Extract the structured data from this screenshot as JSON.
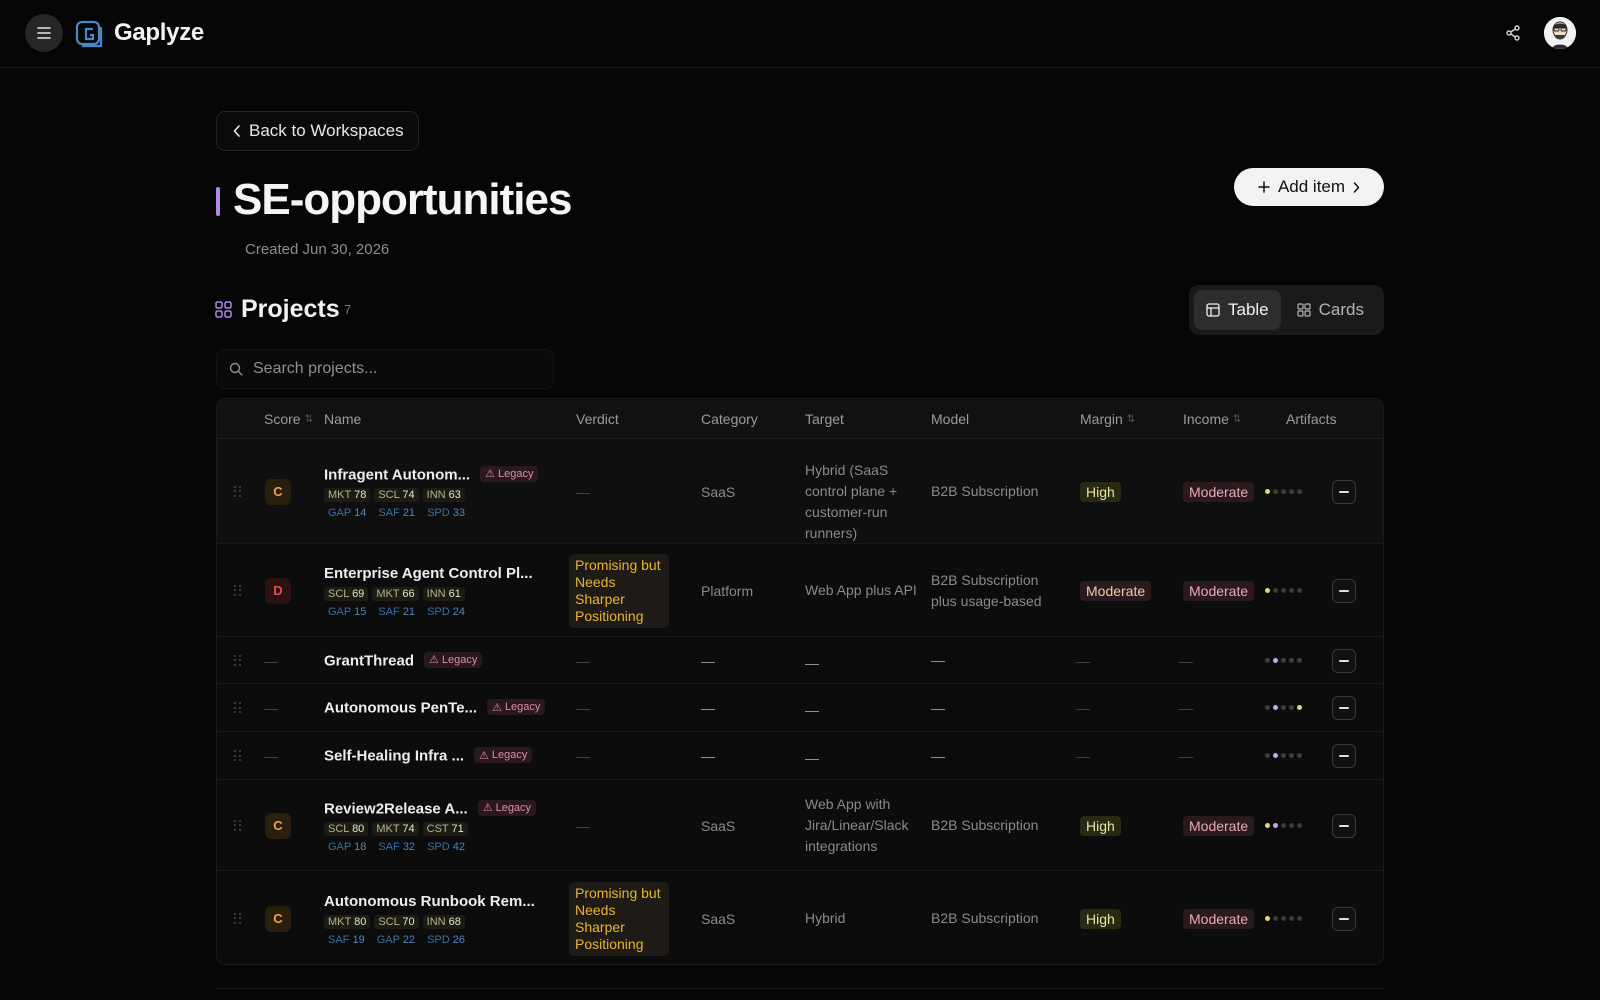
{
  "app": {
    "name": "Gaplyze"
  },
  "nav": {
    "back_label": "Back to Workspaces"
  },
  "page": {
    "title": "SE-opportunities",
    "created": "Created Jun 30, 2026",
    "add_label": "Add item"
  },
  "section": {
    "title": "Projects",
    "count": "7"
  },
  "views": {
    "table": "Table",
    "cards": "Cards",
    "active": "Table"
  },
  "search": {
    "placeholder": "Search projects..."
  },
  "columns": [
    "Score",
    "Name",
    "Verdict",
    "Category",
    "Target",
    "Model",
    "Margin",
    "Income",
    "Artifacts"
  ],
  "dash": "—",
  "legacy_label": "Legacy",
  "rows": [
    {
      "grade": "C",
      "name": "Infragent Autonom...",
      "legacy": true,
      "metrics1": [
        [
          "MKT",
          "78"
        ],
        [
          "SCL",
          "74"
        ],
        [
          "INN",
          "63"
        ]
      ],
      "metrics2": [
        [
          "GAP",
          "14"
        ],
        [
          "SAF",
          "21"
        ],
        [
          "SPD",
          "33"
        ]
      ],
      "verdict": "—",
      "category": "SaaS",
      "target": "Hybrid (SaaS control plane + customer-run runners)",
      "model": "B2B Subscription",
      "margin": "High",
      "income": "Moderate",
      "artifacts": [
        "y",
        "g",
        "g",
        "g",
        "g"
      ]
    },
    {
      "grade": "D",
      "name": "Enterprise Agent Control Pl...",
      "legacy": false,
      "metrics1": [
        [
          "SCL",
          "69"
        ],
        [
          "MKT",
          "66"
        ],
        [
          "INN",
          "61"
        ]
      ],
      "metrics2": [
        [
          "GAP",
          "15"
        ],
        [
          "SAF",
          "21"
        ],
        [
          "SPD",
          "24"
        ]
      ],
      "verdict": "Promising but Needs Sharper Positioning",
      "category": "Platform",
      "target": "Web App plus API",
      "model": "B2B Subscription plus usage-based",
      "margin": "Moderate",
      "income": "Moderate",
      "artifacts": [
        "y",
        "g",
        "g",
        "g",
        "g"
      ]
    },
    {
      "grade": "—",
      "name": "GrantThread",
      "legacy": true,
      "verdict": "—",
      "category": "—",
      "target": "—",
      "model": "—",
      "margin": "—",
      "income": "—",
      "artifacts": [
        "g",
        "p",
        "g",
        "g",
        "g"
      ]
    },
    {
      "grade": "—",
      "name": "Autonomous PenTe...",
      "legacy": true,
      "verdict": "—",
      "category": "—",
      "target": "—",
      "model": "—",
      "margin": "—",
      "income": "—",
      "artifacts": [
        "g",
        "p",
        "g",
        "g",
        "y"
      ]
    },
    {
      "grade": "—",
      "name": "Self-Healing Infra ...",
      "legacy": true,
      "verdict": "—",
      "category": "—",
      "target": "—",
      "model": "—",
      "margin": "—",
      "income": "—",
      "artifacts": [
        "g",
        "p",
        "g",
        "g",
        "g"
      ]
    },
    {
      "grade": "C",
      "name": "Review2Release A...",
      "legacy": true,
      "metrics1": [
        [
          "SCL",
          "80"
        ],
        [
          "MKT",
          "74"
        ],
        [
          "CST",
          "71"
        ]
      ],
      "metrics2": [
        [
          "GAP",
          "18"
        ],
        [
          "SAF",
          "32"
        ],
        [
          "SPD",
          "42"
        ]
      ],
      "verdict": "—",
      "category": "SaaS",
      "target": "Web App with Jira/Linear/Slack integrations",
      "model": "B2B Subscription",
      "margin": "High",
      "income": "Moderate",
      "artifacts": [
        "y",
        "p",
        "g",
        "g",
        "g"
      ]
    },
    {
      "grade": "C",
      "name": "Autonomous Runbook Rem...",
      "legacy": false,
      "metrics1": [
        [
          "MKT",
          "80"
        ],
        [
          "SCL",
          "70"
        ],
        [
          "INN",
          "68"
        ]
      ],
      "metrics2": [
        [
          "SAF",
          "19"
        ],
        [
          "GAP",
          "22"
        ],
        [
          "SPD",
          "26"
        ]
      ],
      "verdict": "Promising but Needs Sharper Positioning",
      "category": "SaaS",
      "target": "Hybrid",
      "model": "B2B Subscription",
      "margin": "High",
      "income": "Moderate",
      "artifacts": [
        "y",
        "g",
        "g",
        "g",
        "g"
      ]
    }
  ]
}
